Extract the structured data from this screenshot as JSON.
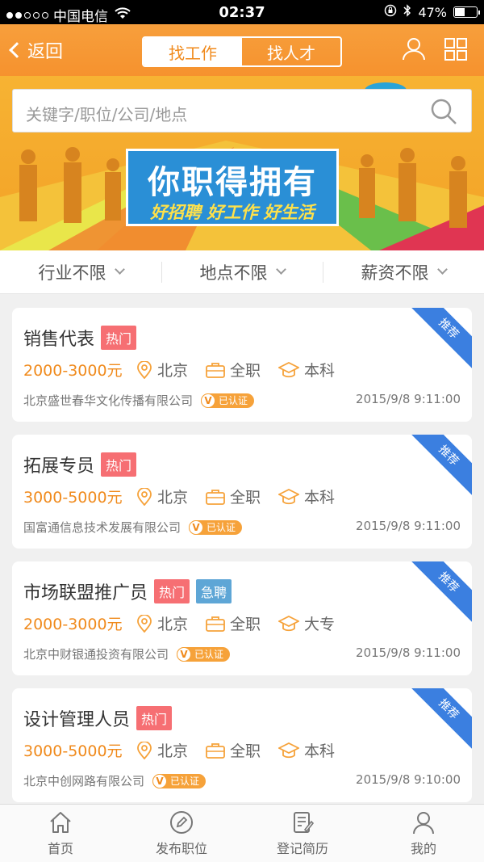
{
  "status_bar": {
    "carrier": "中国电信",
    "time": "02:37",
    "battery": "47%",
    "battery_level": 0.47
  },
  "nav": {
    "back_label": "返回",
    "tabs": [
      "找工作",
      "找人才"
    ],
    "active_tab": 0
  },
  "banner": {
    "search_placeholder": "关键字/职位/公司/地点",
    "slogan": "你职得拥有",
    "subslogan": "好招聘 好工作 好生活"
  },
  "filters": [
    "行业不限",
    "地点不限",
    "薪资不限"
  ],
  "jobs": [
    {
      "title": "销售代表",
      "tags": [
        "热门"
      ],
      "salary": "2000-3000元",
      "location": "北京",
      "type": "全职",
      "education": "本科",
      "company": "北京盛世春华文化传播有限公司",
      "certified": "已认证",
      "date": "2015/9/8 9:11:00",
      "badge": "推荐"
    },
    {
      "title": "拓展专员",
      "tags": [
        "热门"
      ],
      "salary": "3000-5000元",
      "location": "北京",
      "type": "全职",
      "education": "本科",
      "company": "国富通信息技术发展有限公司",
      "certified": "已认证",
      "date": "2015/9/8 9:11:00",
      "badge": "推荐"
    },
    {
      "title": "市场联盟推广员",
      "tags": [
        "热门",
        "急聘"
      ],
      "salary": "2000-3000元",
      "location": "北京",
      "type": "全职",
      "education": "大专",
      "company": "北京中财银通投资有限公司",
      "certified": "已认证",
      "date": "2015/9/8 9:11:00",
      "badge": "推荐"
    },
    {
      "title": "设计管理人员",
      "tags": [
        "热门"
      ],
      "salary": "3000-5000元",
      "location": "北京",
      "type": "全职",
      "education": "本科",
      "company": "北京中创网路有限公司",
      "certified": "已认证",
      "date": "2015/9/8 9:10:00",
      "badge": "推荐"
    }
  ],
  "tabbar": [
    {
      "label": "首页",
      "icon": "home-icon"
    },
    {
      "label": "发布职位",
      "icon": "edit-icon"
    },
    {
      "label": "登记简历",
      "icon": "resume-icon"
    },
    {
      "label": "我的",
      "icon": "profile-icon"
    }
  ],
  "colors": {
    "accent": "#f6922e",
    "ribbon": "#3b7fe0",
    "hot": "#f66f73",
    "urgent": "#5ea6d6"
  }
}
